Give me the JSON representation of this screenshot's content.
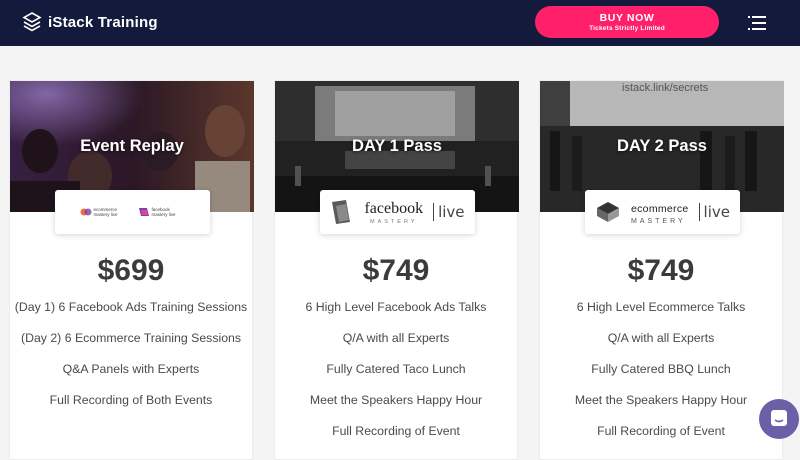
{
  "header": {
    "brand": "iStack Training",
    "buy_label": "BUY NOW",
    "buy_sub": "Tickets Strictly Limited"
  },
  "cards": [
    {
      "title": "Event Replay",
      "price": "$699",
      "logos": [
        "ecommerce mastery live",
        "facebook mastery live"
      ],
      "features": [
        "(Day 1) 6 Facebook Ads Training Sessions",
        "(Day 2) 6 Ecommerce Training Sessions",
        "Q&A Panels with Experts",
        "Full Recording of Both Events"
      ]
    },
    {
      "title": "DAY 1 Pass",
      "price": "$749",
      "logo": {
        "word": "facebook",
        "sub": "MASTERY",
        "live": "live"
      },
      "features": [
        "6 High Level Facebook Ads Talks",
        "Q/A with all Experts",
        "Fully Catered Taco Lunch",
        "Meet the Speakers Happy Hour",
        "Full Recording of Event"
      ]
    },
    {
      "title": "DAY 2 Pass",
      "price": "$749",
      "hero_text": "istack.link/secrets",
      "logo": {
        "word": "ecommerce",
        "sub": "MASTERY",
        "live": "live"
      },
      "features": [
        "6 High Level Ecommerce Talks",
        "Q/A with all Experts",
        "Fully Catered BBQ Lunch",
        "Meet the Speakers Happy Hour",
        "Full Recording of Event"
      ]
    }
  ],
  "colors": {
    "header_bg": "#141a3c",
    "buy_bg": "#ff1f6b",
    "chat_bg": "#6b5fa8",
    "price_text": "#3b3b3b"
  },
  "icons": [
    "istack-logo-icon",
    "hamburger-menu-icon",
    "chat-icon"
  ]
}
